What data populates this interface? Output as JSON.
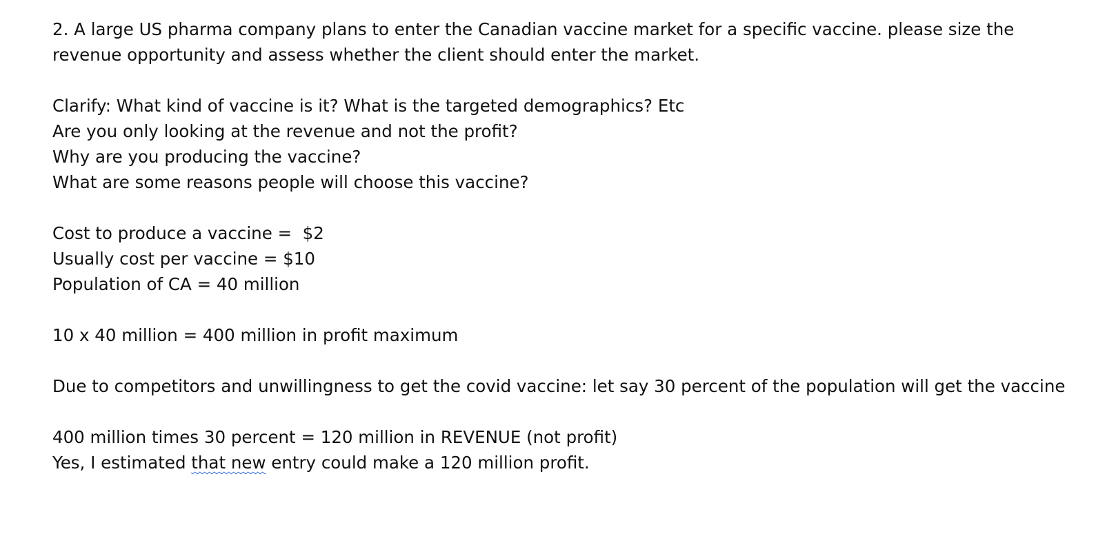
{
  "question": {
    "text": "2. A large US pharma company plans to enter the Canadian vaccine market for a specific vaccine. please size the revenue opportunity and assess whether the client should enter the market."
  },
  "clarify": {
    "lines": [
      "Clarify: What kind of vaccine is it? What is the targeted demographics? Etc",
      "Are you only looking at the revenue and not the profit?",
      "Why are you producing the vaccine?",
      "What are some reasons people will choose this vaccine?"
    ]
  },
  "assumptions": {
    "lines": [
      "Cost to produce a vaccine =  $2",
      "Usually cost per vaccine = $10",
      "Population of CA = 40 million"
    ]
  },
  "calculation": {
    "max_line": "10 x 40 million = 400 million in profit maximum"
  },
  "adjustment": {
    "text": "Due to competitors and unwillingness to get the covid vaccine: let say 30 percent of the population will get the vaccine"
  },
  "conclusion": {
    "revenue_line": "400 million times 30 percent = 120 million in REVENUE (not profit)",
    "final_prefix": "Yes, I estimated ",
    "final_flagged": "that new",
    "final_suffix": " entry could make a 120 million profit."
  }
}
